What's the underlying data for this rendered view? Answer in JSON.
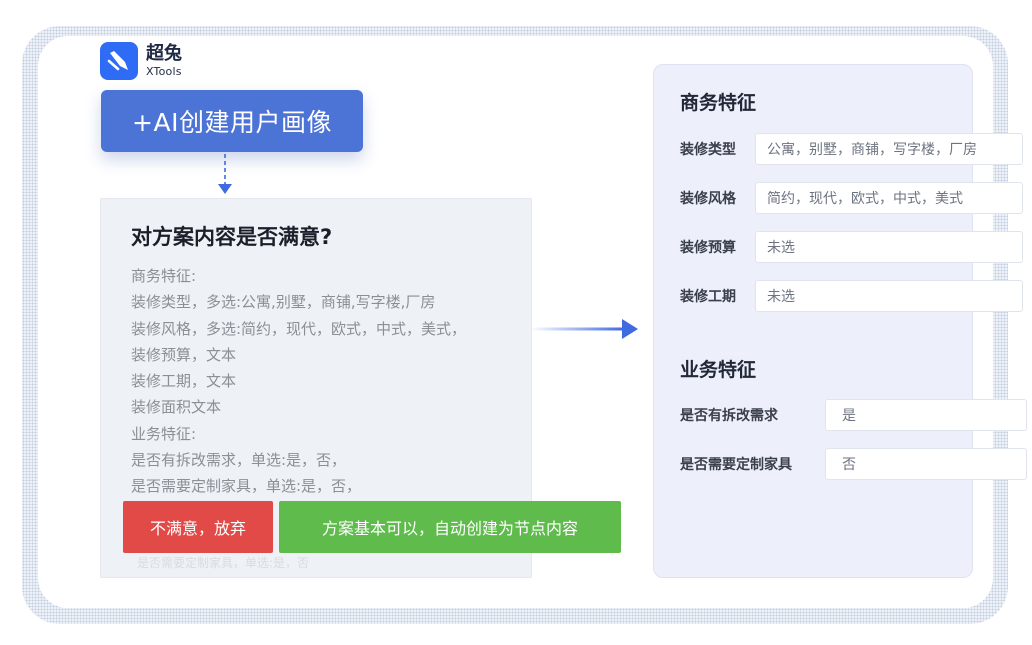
{
  "logo": {
    "name_cn": "超兔",
    "name_en": "XTools"
  },
  "create_button": {
    "label": "+AI创建用户画像"
  },
  "question": {
    "title": "对方案内容是否满意?",
    "lines": [
      "商务特征:",
      "装修类型，多选:公寓,别墅，商铺,写字楼,厂房",
      "装修风格，多选:简约，现代，欧式，中式，美式，",
      "装修预算，文本",
      "装修工期，文本",
      "装修面积文本",
      "业务特征:",
      "是否有拆改需求，单选:是，否，",
      "是否需要定制家具，单选:是，否，"
    ],
    "faded_text": "是否需要定制家具，单选:是，否"
  },
  "actions": {
    "reject_label": "不满意，放弃",
    "accept_label": "方案基本可以，自动创建为节点内容"
  },
  "panel": {
    "business_title": "商务特征",
    "business_fields": [
      {
        "label": "装修类型",
        "value": "公寓，别墅，商铺，写字楼，厂房"
      },
      {
        "label": "装修风格",
        "value": "简约，现代，欧式，中式，美式"
      },
      {
        "label": "装修预算",
        "value": "未选"
      },
      {
        "label": "装修工期",
        "value": "未选"
      }
    ],
    "operation_title": "业务特征",
    "operation_fields": [
      {
        "label": "是否有拆改需求",
        "value": "是"
      },
      {
        "label": "是否需要定制家具",
        "value": "否"
      }
    ]
  },
  "colors": {
    "primary_button": "#4c73d6",
    "reject_button": "#e24a48",
    "accept_button": "#5fbb4c",
    "arrow": "#3f6ae0",
    "logo": "#2f6cf6"
  }
}
